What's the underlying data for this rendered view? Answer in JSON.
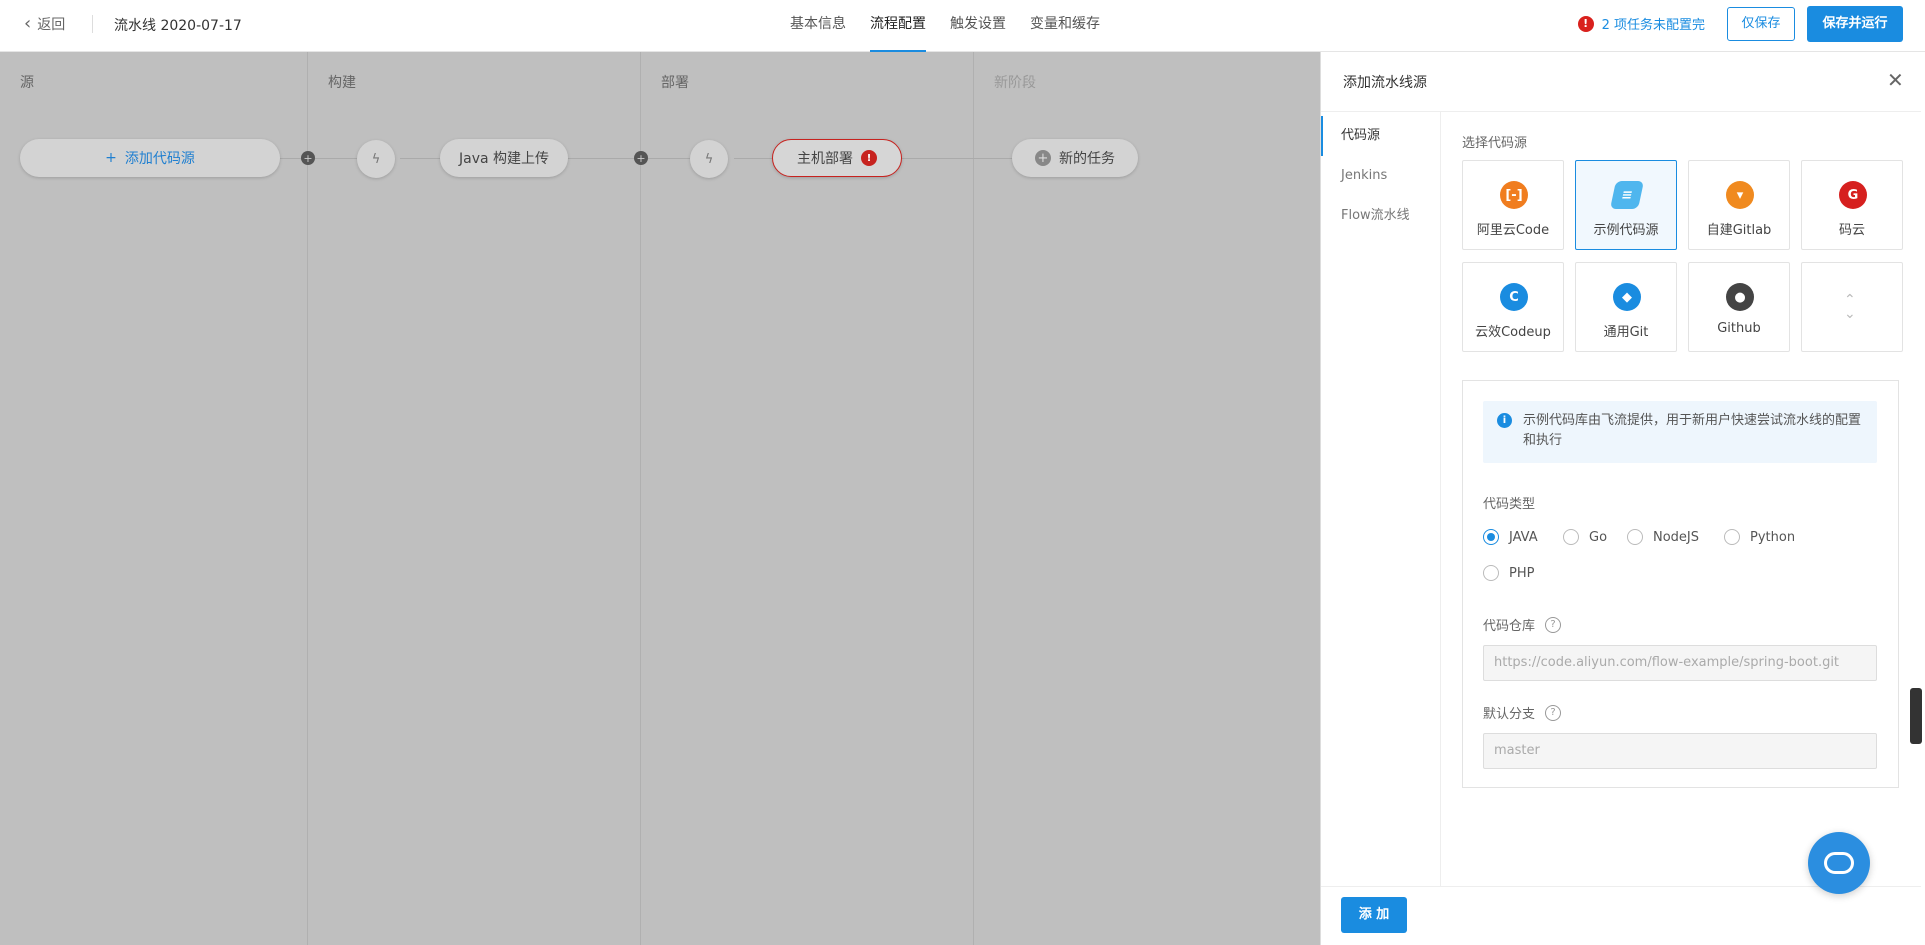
{
  "header": {
    "back_label": "返回",
    "pipeline_title": "流水线 2020-07-17",
    "tabs": [
      "基本信息",
      "流程配置",
      "触发设置",
      "变量和缓存"
    ],
    "warning_text": "2 项任务未配置完",
    "save_only_label": "仅保存",
    "save_run_label": "保存并运行"
  },
  "stages": [
    {
      "title": "源",
      "add_label": "添加代码源"
    },
    {
      "title": "构建",
      "task": "Java 构建上传"
    },
    {
      "title": "部署",
      "task": "主机部署"
    },
    {
      "title": "新阶段",
      "task": "新的任务"
    }
  ],
  "panel": {
    "title": "添加流水线源",
    "nav": [
      "代码源",
      "Jenkins",
      "Flow流水线"
    ],
    "choose_label": "选择代码源",
    "sources": [
      {
        "name": "阿里云Code",
        "icon": "aliyun-code-icon",
        "color": "#f07d1f"
      },
      {
        "name": "示例代码源",
        "icon": "sample-source-icon",
        "color": "#4fb6ee"
      },
      {
        "name": "自建Gitlab",
        "icon": "gitlab-icon",
        "color": "#f08a1f"
      },
      {
        "name": "码云",
        "icon": "gitee-icon",
        "color": "#d6201f"
      },
      {
        "name": "云效Codeup",
        "icon": "codeup-icon",
        "color": "#1a8ce0"
      },
      {
        "name": "通用Git",
        "icon": "git-icon",
        "color": "#1a8ce0"
      },
      {
        "name": "Github",
        "icon": "github-icon",
        "color": "#444444"
      }
    ],
    "info_text": "示例代码库由飞流提供，用于新用户快速尝试流水线的配置和执行",
    "code_type_label": "代码类型",
    "code_types": [
      "JAVA",
      "Go",
      "NodeJS",
      "Python",
      "PHP"
    ],
    "code_type_selected": "JAVA",
    "repo_label": "代码仓库",
    "repo_value": "https://code.aliyun.com/flow-example/spring-boot.git",
    "branch_label": "默认分支",
    "branch_value": "master",
    "add_button": "添 加"
  }
}
